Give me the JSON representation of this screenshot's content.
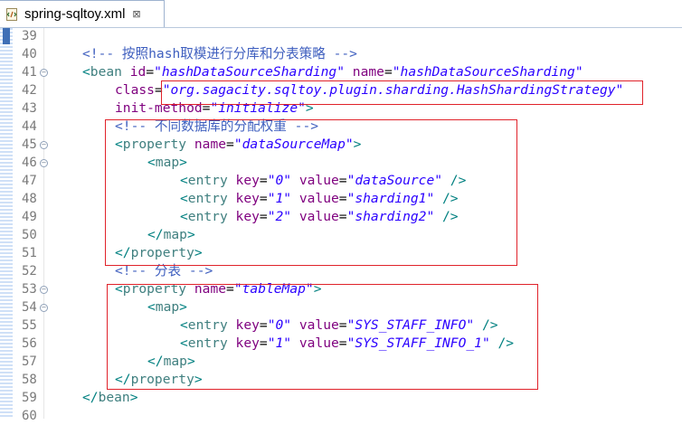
{
  "tab": {
    "title": "spring-sqltoy.xml",
    "close_glyph": "⊠",
    "icon": "xml-file-icon"
  },
  "colors": {
    "tag": "#3f7f7f",
    "attribute": "#7f007f",
    "value": "#2a00ff",
    "comment": "#3f5fbf",
    "highlight_box": "#e0222a"
  },
  "lines": [
    {
      "num": "39",
      "fold": false,
      "indent": 0,
      "tokens": []
    },
    {
      "num": "40",
      "fold": false,
      "indent": 1,
      "tokens": [
        {
          "t": "<!-- 按照hash取模进行分库和分表策略 -->",
          "c": "cmt"
        }
      ]
    },
    {
      "num": "41",
      "fold": true,
      "indent": 1,
      "tokens": [
        {
          "t": "<",
          "c": "pun"
        },
        {
          "t": "bean",
          "c": "tag"
        },
        {
          "t": " ",
          "c": ""
        },
        {
          "t": "id",
          "c": "attr"
        },
        {
          "t": "=",
          "c": ""
        },
        {
          "t": "\"hashDataSourceSharding\"",
          "c": "val"
        },
        {
          "t": " ",
          "c": ""
        },
        {
          "t": "name",
          "c": "attr"
        },
        {
          "t": "=",
          "c": ""
        },
        {
          "t": "\"hashDataSourceSharding\"",
          "c": "val"
        }
      ]
    },
    {
      "num": "42",
      "fold": false,
      "indent": 2,
      "tokens": [
        {
          "t": "class",
          "c": "attr"
        },
        {
          "t": "=",
          "c": ""
        },
        {
          "t": "\"org.sagacity.sqltoy.plugin.sharding.HashShardingStrategy\"",
          "c": "val"
        }
      ]
    },
    {
      "num": "43",
      "fold": false,
      "indent": 2,
      "tokens": [
        {
          "t": "init-method",
          "c": "attr"
        },
        {
          "t": "=",
          "c": ""
        },
        {
          "t": "\"initialize\"",
          "c": "val"
        },
        {
          "t": ">",
          "c": "pun"
        }
      ]
    },
    {
      "num": "44",
      "fold": false,
      "indent": 2,
      "tokens": [
        {
          "t": "<!-- 不同数据库的分配权重 -->",
          "c": "cmt"
        }
      ]
    },
    {
      "num": "45",
      "fold": true,
      "indent": 2,
      "tokens": [
        {
          "t": "<",
          "c": "pun"
        },
        {
          "t": "property",
          "c": "tag"
        },
        {
          "t": " ",
          "c": ""
        },
        {
          "t": "name",
          "c": "attr"
        },
        {
          "t": "=",
          "c": ""
        },
        {
          "t": "\"dataSourceMap\"",
          "c": "val"
        },
        {
          "t": ">",
          "c": "pun"
        }
      ]
    },
    {
      "num": "46",
      "fold": true,
      "indent": 3,
      "tokens": [
        {
          "t": "<",
          "c": "pun"
        },
        {
          "t": "map",
          "c": "tag"
        },
        {
          "t": ">",
          "c": "pun"
        }
      ]
    },
    {
      "num": "47",
      "fold": false,
      "indent": 4,
      "tokens": [
        {
          "t": "<",
          "c": "pun"
        },
        {
          "t": "entry",
          "c": "tag"
        },
        {
          "t": " ",
          "c": ""
        },
        {
          "t": "key",
          "c": "attr"
        },
        {
          "t": "=",
          "c": ""
        },
        {
          "t": "\"0\"",
          "c": "val"
        },
        {
          "t": " ",
          "c": ""
        },
        {
          "t": "value",
          "c": "attr"
        },
        {
          "t": "=",
          "c": ""
        },
        {
          "t": "\"dataSource\"",
          "c": "val"
        },
        {
          "t": " />",
          "c": "pun"
        }
      ]
    },
    {
      "num": "48",
      "fold": false,
      "indent": 4,
      "tokens": [
        {
          "t": "<",
          "c": "pun"
        },
        {
          "t": "entry",
          "c": "tag"
        },
        {
          "t": " ",
          "c": ""
        },
        {
          "t": "key",
          "c": "attr"
        },
        {
          "t": "=",
          "c": ""
        },
        {
          "t": "\"1\"",
          "c": "val"
        },
        {
          "t": " ",
          "c": ""
        },
        {
          "t": "value",
          "c": "attr"
        },
        {
          "t": "=",
          "c": ""
        },
        {
          "t": "\"sharding1\"",
          "c": "val"
        },
        {
          "t": " />",
          "c": "pun"
        }
      ]
    },
    {
      "num": "49",
      "fold": false,
      "indent": 4,
      "tokens": [
        {
          "t": "<",
          "c": "pun"
        },
        {
          "t": "entry",
          "c": "tag"
        },
        {
          "t": " ",
          "c": ""
        },
        {
          "t": "key",
          "c": "attr"
        },
        {
          "t": "=",
          "c": ""
        },
        {
          "t": "\"2\"",
          "c": "val"
        },
        {
          "t": " ",
          "c": ""
        },
        {
          "t": "value",
          "c": "attr"
        },
        {
          "t": "=",
          "c": ""
        },
        {
          "t": "\"sharding2\"",
          "c": "val"
        },
        {
          "t": " />",
          "c": "pun"
        }
      ]
    },
    {
      "num": "50",
      "fold": false,
      "indent": 3,
      "tokens": [
        {
          "t": "</",
          "c": "pun"
        },
        {
          "t": "map",
          "c": "tag"
        },
        {
          "t": ">",
          "c": "pun"
        }
      ]
    },
    {
      "num": "51",
      "fold": false,
      "indent": 2,
      "tokens": [
        {
          "t": "</",
          "c": "pun"
        },
        {
          "t": "property",
          "c": "tag"
        },
        {
          "t": ">",
          "c": "pun"
        }
      ]
    },
    {
      "num": "52",
      "fold": false,
      "indent": 2,
      "tokens": [
        {
          "t": "<!-- 分表 -->",
          "c": "cmt"
        }
      ]
    },
    {
      "num": "53",
      "fold": true,
      "indent": 2,
      "tokens": [
        {
          "t": "<",
          "c": "pun"
        },
        {
          "t": "property",
          "c": "tag"
        },
        {
          "t": " ",
          "c": ""
        },
        {
          "t": "name",
          "c": "attr"
        },
        {
          "t": "=",
          "c": ""
        },
        {
          "t": "\"tableMap\"",
          "c": "val"
        },
        {
          "t": ">",
          "c": "pun"
        }
      ]
    },
    {
      "num": "54",
      "fold": true,
      "indent": 3,
      "tokens": [
        {
          "t": "<",
          "c": "pun"
        },
        {
          "t": "map",
          "c": "tag"
        },
        {
          "t": ">",
          "c": "pun"
        }
      ]
    },
    {
      "num": "55",
      "fold": false,
      "indent": 4,
      "tokens": [
        {
          "t": "<",
          "c": "pun"
        },
        {
          "t": "entry",
          "c": "tag"
        },
        {
          "t": " ",
          "c": ""
        },
        {
          "t": "key",
          "c": "attr"
        },
        {
          "t": "=",
          "c": ""
        },
        {
          "t": "\"0\"",
          "c": "val"
        },
        {
          "t": " ",
          "c": ""
        },
        {
          "t": "value",
          "c": "attr"
        },
        {
          "t": "=",
          "c": ""
        },
        {
          "t": "\"SYS_STAFF_INFO\"",
          "c": "val"
        },
        {
          "t": " />",
          "c": "pun"
        }
      ]
    },
    {
      "num": "56",
      "fold": false,
      "indent": 4,
      "tokens": [
        {
          "t": "<",
          "c": "pun"
        },
        {
          "t": "entry",
          "c": "tag"
        },
        {
          "t": " ",
          "c": ""
        },
        {
          "t": "key",
          "c": "attr"
        },
        {
          "t": "=",
          "c": ""
        },
        {
          "t": "\"1\"",
          "c": "val"
        },
        {
          "t": " ",
          "c": ""
        },
        {
          "t": "value",
          "c": "attr"
        },
        {
          "t": "=",
          "c": ""
        },
        {
          "t": "\"SYS_STAFF_INFO_1\"",
          "c": "val"
        },
        {
          "t": " />",
          "c": "pun"
        }
      ]
    },
    {
      "num": "57",
      "fold": false,
      "indent": 3,
      "tokens": [
        {
          "t": "</",
          "c": "pun"
        },
        {
          "t": "map",
          "c": "tag"
        },
        {
          "t": ">",
          "c": "pun"
        }
      ]
    },
    {
      "num": "58",
      "fold": false,
      "indent": 2,
      "tokens": [
        {
          "t": "</",
          "c": "pun"
        },
        {
          "t": "property",
          "c": "tag"
        },
        {
          "t": ">",
          "c": "pun"
        }
      ]
    },
    {
      "num": "59",
      "fold": false,
      "indent": 1,
      "tokens": [
        {
          "t": "</",
          "c": "pun"
        },
        {
          "t": "bean",
          "c": "tag"
        },
        {
          "t": ">",
          "c": "pun"
        }
      ]
    },
    {
      "num": "60",
      "fold": false,
      "indent": 0,
      "tokens": []
    }
  ]
}
